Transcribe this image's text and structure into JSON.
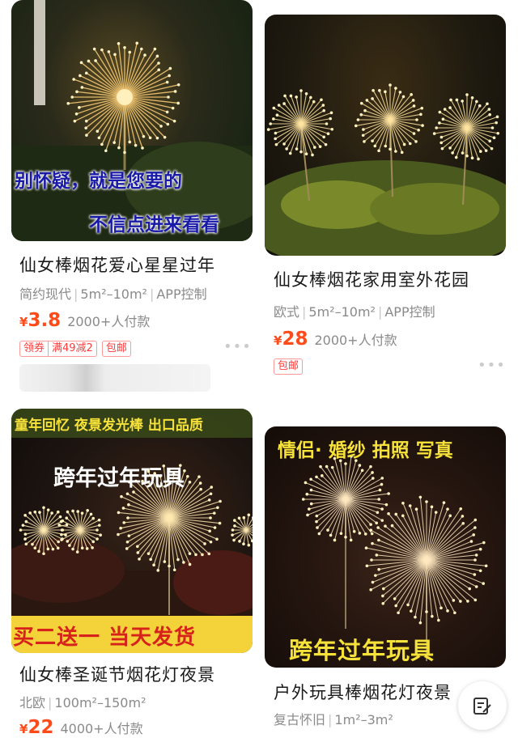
{
  "products": [
    {
      "overlay": [
        "别怀疑，就是您要的",
        "不信点进来看看"
      ],
      "title": "仙女棒烟花爱心星星过年",
      "specs": [
        "简约现代",
        "5m²–10m²",
        "APP控制"
      ],
      "currency": "¥",
      "price": "3.8",
      "sales": "2000+人付款",
      "tags": {
        "coupon_left": "领券",
        "coupon_right": "满49减2",
        "shipping": "包邮"
      },
      "more_icon": "more-dots-icon"
    },
    {
      "overlay": [],
      "title": "仙女棒烟花家用室外花园",
      "specs": [
        "欧式",
        "5m²–10m²",
        "APP控制"
      ],
      "currency": "¥",
      "price": "28",
      "sales": "2000+人付款",
      "tags": {
        "shipping": "包邮"
      },
      "more_icon": "more-dots-icon"
    },
    {
      "overlay": [
        "童年回忆 夜景发光棒 出口品质",
        "跨年过年玩具",
        "买二送一  当天发货"
      ],
      "title": "仙女棒圣诞节烟花灯夜景",
      "specs": [
        "北欧",
        "100m²–150m²"
      ],
      "currency": "¥",
      "price": "22",
      "sales": "4000+人付款"
    },
    {
      "overlay": [
        "情侣· 婚纱  拍照  写真",
        "跨年过年玩具"
      ],
      "title": "户外玩具棒烟花灯夜景",
      "specs": [
        "复古怀旧",
        "1m²–3m²"
      ]
    }
  ],
  "floating_button_icon": "edit-note-icon",
  "colors": {
    "price": "#ff4a1a",
    "tag": "#ff3b3b",
    "muted": "#8a8a8a",
    "overlay_blue": "#1a1aa8",
    "overlay_yellow": "#f7e23a",
    "promo_red": "#d6221b"
  }
}
